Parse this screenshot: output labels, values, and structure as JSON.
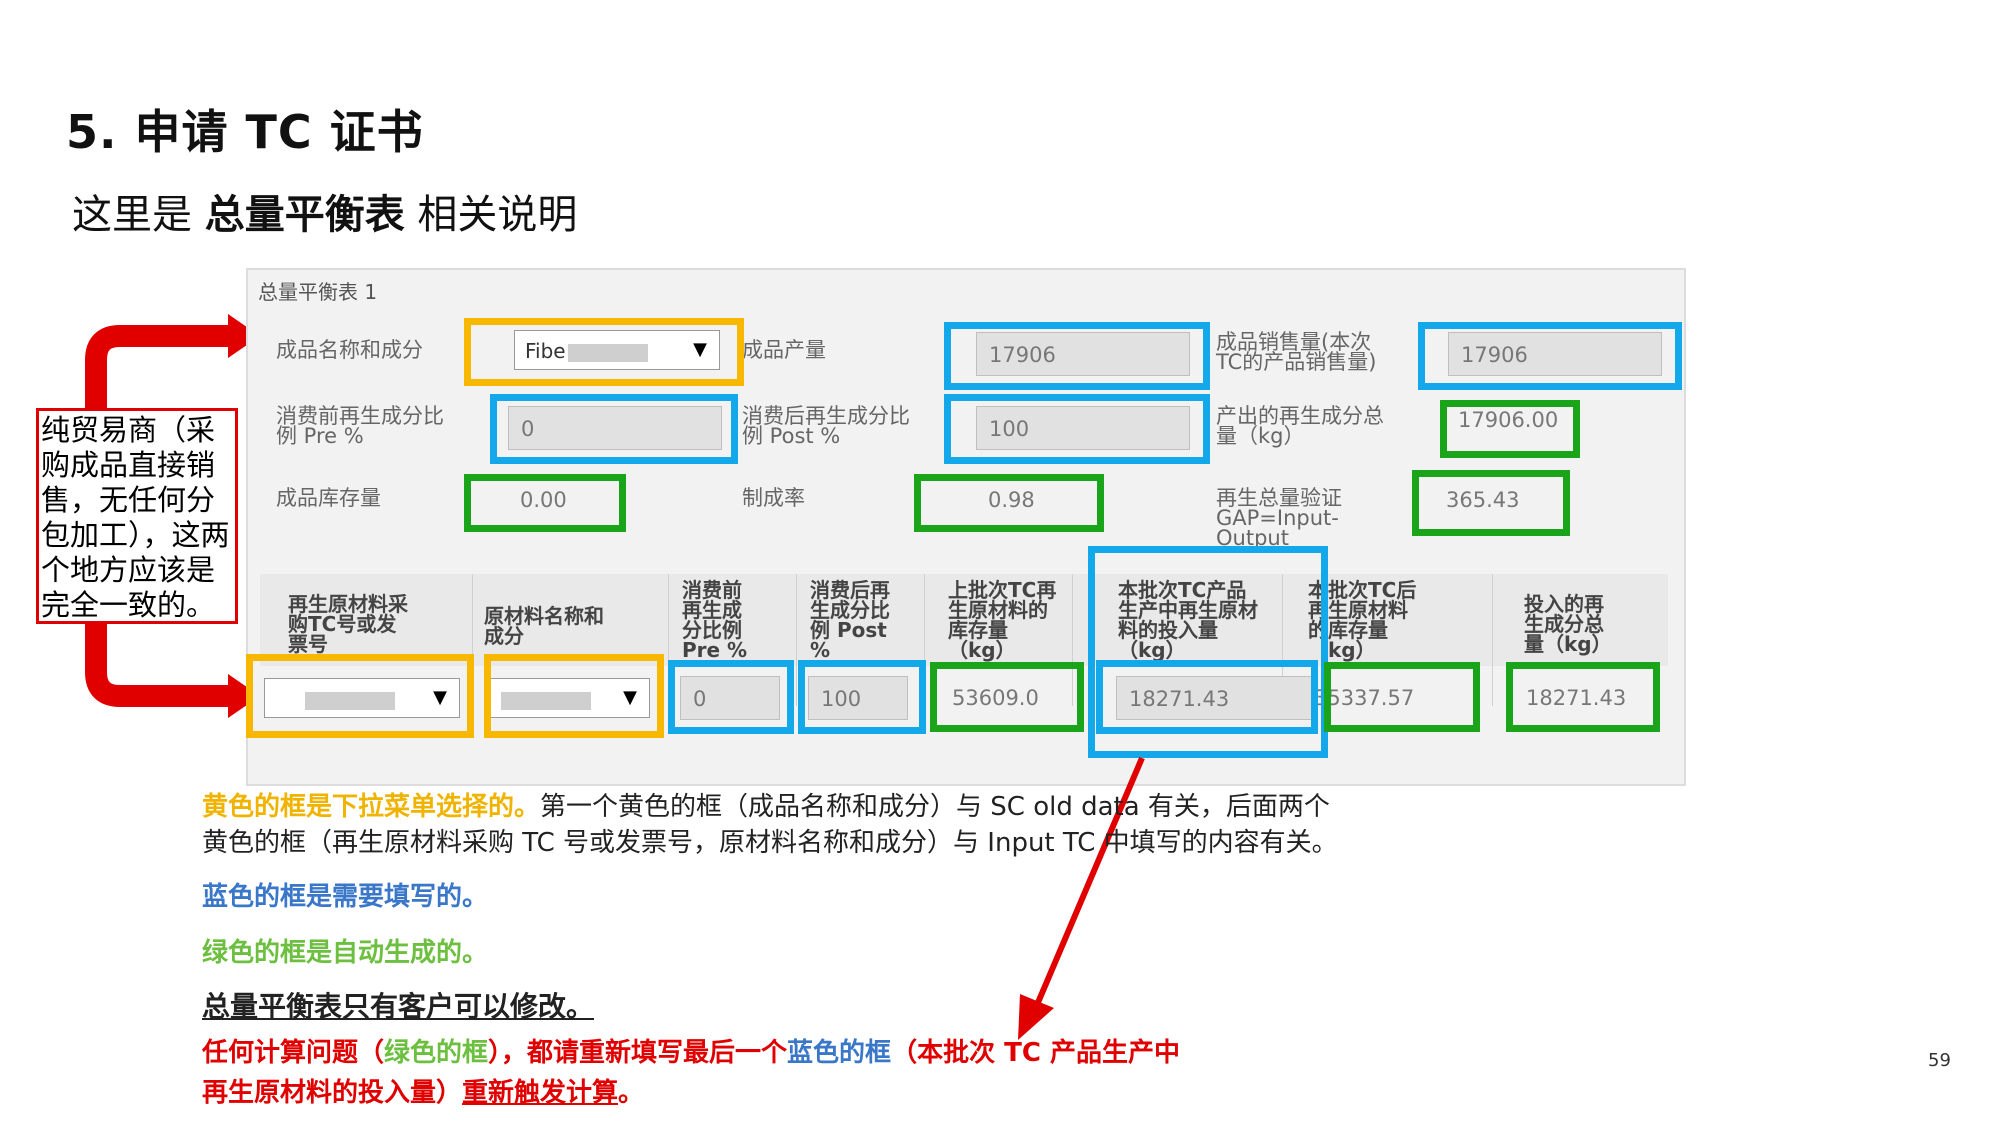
{
  "slide": {
    "title": "5. 申请 TC 证书",
    "subtitle_prefix": "这里是 ",
    "subtitle_bold": "总量平衡表",
    "subtitle_suffix": " 相关说明",
    "page_number": "59"
  },
  "panel": {
    "title": "总量平衡表 1",
    "product_name_label": "成品名称和成分",
    "product_name_value": "Fibe",
    "product_output_label": "成品产量",
    "product_output_value": "17906",
    "product_sales_label_1": "成品销售量(本次",
    "product_sales_label_2": "TC的产品销售量)",
    "product_sales_value": "17906",
    "pre_label_1": "消费前再生成分比",
    "pre_label_2": "例 Pre %",
    "pre_value": "0",
    "post_label_1": "消费后再生成分比",
    "post_label_2": "例 Post %",
    "post_value": "100",
    "recycled_total_label_1": "产出的再生成分总",
    "recycled_total_label_2": "量（kg）",
    "recycled_total_value": "17906.00",
    "stock_label": "成品库存量",
    "stock_value": "0.00",
    "yield_label": "制成率",
    "yield_value": "0.98",
    "gap_label_1": "再生总量验证",
    "gap_label_2": "GAP=Input-",
    "gap_label_3": "Output",
    "gap_value": "365.43",
    "table_headers": [
      [
        "再生原材料采",
        "购TC号或发",
        "票号"
      ],
      [
        "原材料名称和",
        "成分"
      ],
      [
        "消费前",
        "再生成",
        "分比例",
        "Pre %"
      ],
      [
        "消费后再",
        "生成分比",
        "例 Post",
        "%"
      ],
      [
        "上批次TC再",
        "生原材料的",
        "库存量",
        "（kg）"
      ],
      [
        "本批次TC产品",
        "生产中再生原材",
        "料的投入量",
        "（kg）"
      ],
      [
        "本批次TC后",
        "再生原材料",
        "的库存量",
        "（kg）"
      ],
      [
        "投入的再",
        "生成分总",
        "量（kg）"
      ]
    ],
    "row": {
      "pre": "0",
      "post": "100",
      "prev_stock": "53609.0",
      "input_qty": "18271.43",
      "after_stock": "35337.57",
      "total_input": "18271.43"
    }
  },
  "note": "纯贸易商（采购成品直接销售，无任何分包加工），这两个地方应该是完全一致的。",
  "desc": {
    "l1_yellow": "黄色的框是下拉菜单选择的。",
    "l1_rest": "第一个黄色的框（成品名称和成分）与 SC old data 有关，后面两个",
    "l2": "黄色的框（再生原材料采购 TC 号或发票号，原材料名称和成分）与 Input TC 中填写的内容有关。",
    "l3": "蓝色的框是需要填写的。",
    "l4": "绿色的框是自动生成的。",
    "l5": "总量平衡表只有客户可以修改。",
    "l6_red_a": "任何计算问题（",
    "l6_green": "绿色的框",
    "l6_red_b": "），都请重新填写最后一个",
    "l6_blue": "蓝色的框",
    "l6_red_c": "（本批次 TC 产品生产中",
    "l7_red": "再生原材料的投入量）",
    "l7_underline": "重新触发计算",
    "l7_end": "。"
  },
  "colors": {
    "yellow": "#f8b700",
    "blue": "#12a8ea",
    "green": "#1aa41a",
    "red": "#e00000"
  }
}
